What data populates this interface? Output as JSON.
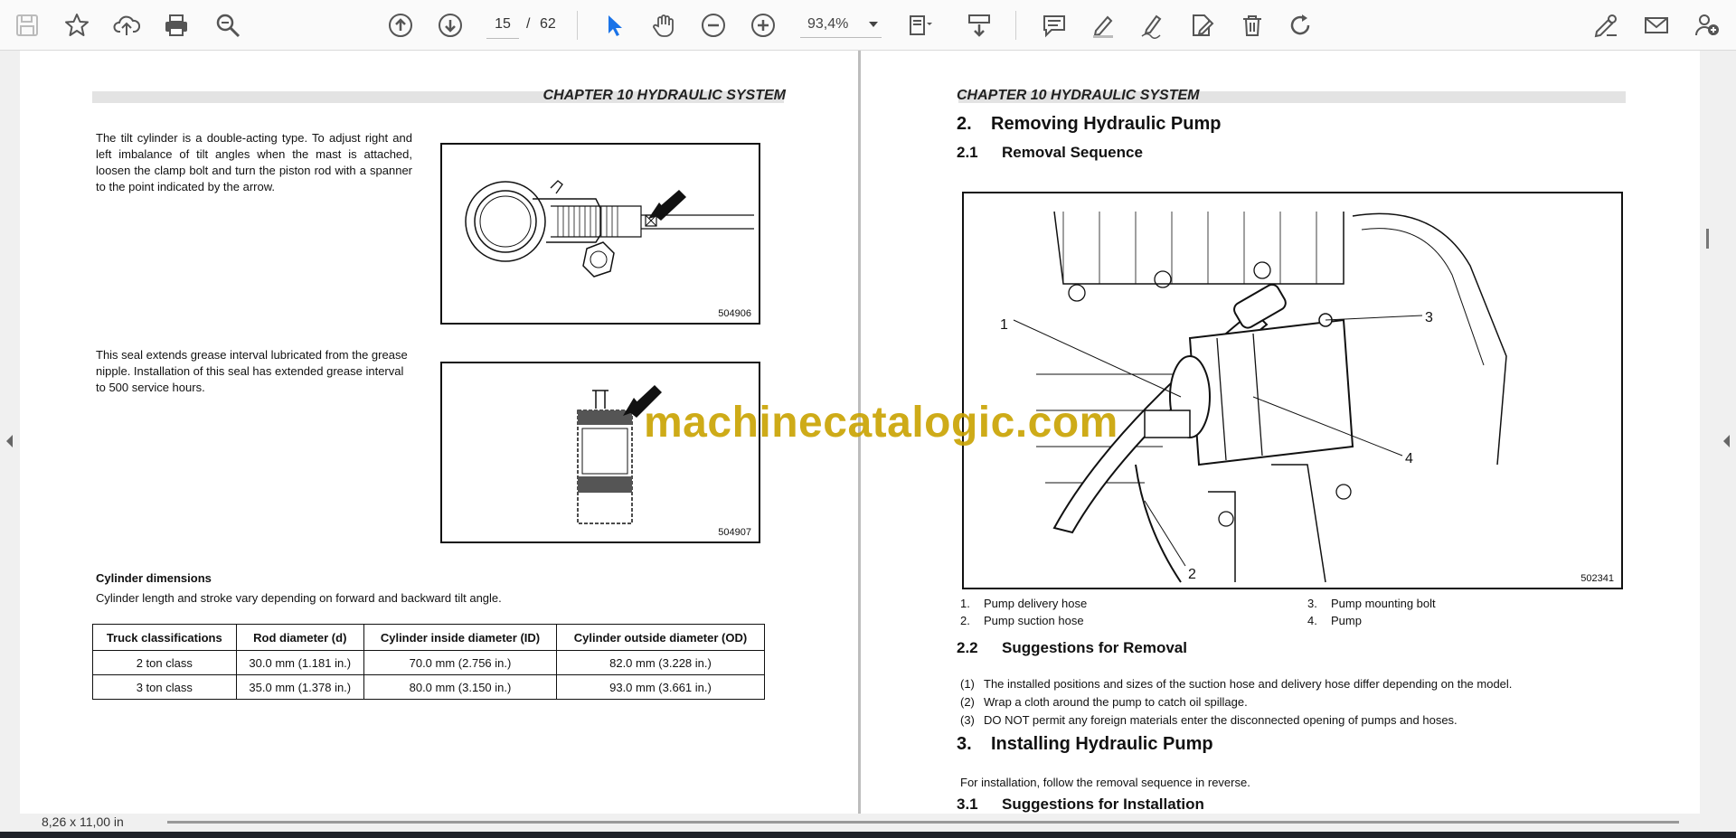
{
  "toolbar": {
    "current_page": "15",
    "page_separator": "/",
    "total_pages": "62",
    "zoom": "93,4%"
  },
  "left_page": {
    "chapter_header": "CHAPTER 10 HYDRAULIC SYSTEM",
    "tilt_paragraph": "The tilt cylinder is a double-acting type. To adjust right and left imbalance of tilt angles when the mast is attached, loosen the clamp bolt and turn the piston rod with a spanner to the point indicated by the arrow.",
    "figure1_id": "504906",
    "seal_paragraph": "This seal extends grease interval lubricated from the grease nipple. Installation of this seal has extended grease interval to 500 service hours.",
    "figure2_id": "504907",
    "cylinder_heading": "Cylinder dimensions",
    "cylinder_note": "Cylinder length and stroke vary depending on forward and backward tilt angle.",
    "table": {
      "headers": [
        "Truck classifications",
        "Rod diameter (d)",
        "Cylinder inside diameter (ID)",
        "Cylinder outside diameter (OD)"
      ],
      "rows": [
        [
          "2 ton class",
          "30.0 mm (1.181 in.)",
          "70.0 mm (2.756 in.)",
          "82.0 mm (3.228 in.)"
        ],
        [
          "3 ton class",
          "35.0 mm (1.378 in.)",
          "80.0 mm (3.150 in.)",
          "93.0 mm (3.661 in.)"
        ]
      ]
    }
  },
  "right_page": {
    "chapter_header": "CHAPTER 10 HYDRAULIC SYSTEM",
    "section2_num": "2.",
    "section2_title": "Removing Hydraulic Pump",
    "section21_num": "2.1",
    "section21_title": "Removal Sequence",
    "figure_id": "502341",
    "callouts": [
      "1",
      "2",
      "3",
      "4"
    ],
    "legend": [
      {
        "num": "1.",
        "text": "Pump delivery hose"
      },
      {
        "num": "2.",
        "text": "Pump suction hose"
      },
      {
        "num": "3.",
        "text": "Pump mounting bolt"
      },
      {
        "num": "4.",
        "text": "Pump"
      }
    ],
    "section22_num": "2.2",
    "section22_title": "Suggestions for Removal",
    "suggestions": [
      {
        "num": "(1)",
        "text": "The installed positions and sizes of the suction hose and delivery hose differ depending on the model."
      },
      {
        "num": "(2)",
        "text": "Wrap a cloth around the pump to catch oil spillage."
      },
      {
        "num": "(3)",
        "text": "DO NOT permit any foreign materials enter the disconnected opening of pumps and hoses."
      }
    ],
    "section3_num": "3.",
    "section3_title": "Installing Hydraulic Pump",
    "install_note": "For installation, follow the removal sequence in reverse.",
    "section31_num": "3.1",
    "section31_title": "Suggestions for Installation"
  },
  "watermark": "machinecatalogic.com",
  "status": {
    "page_size": "8,26 x 11,00 in"
  },
  "colors": {
    "accent_blue": "#1a73e8",
    "watermark": "#c9a300",
    "toolbar_icon": "#555555"
  }
}
